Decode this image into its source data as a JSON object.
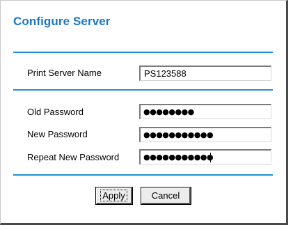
{
  "header": {
    "title": "Configure Server"
  },
  "form": {
    "server_name": {
      "label": "Print Server Name",
      "value": "PS123588"
    },
    "old_password": {
      "label": "Old Password",
      "masked": "●●●●●●●●"
    },
    "new_password": {
      "label": "New Password",
      "masked": "●●●●●●●●●●●"
    },
    "repeat_password": {
      "label": "Repeat New Password",
      "masked": "●●●●●●●●●●●"
    }
  },
  "buttons": {
    "apply": "Apply",
    "cancel": "Cancel"
  },
  "colors": {
    "accent": "#1E90D8",
    "title": "#1A78C2"
  }
}
